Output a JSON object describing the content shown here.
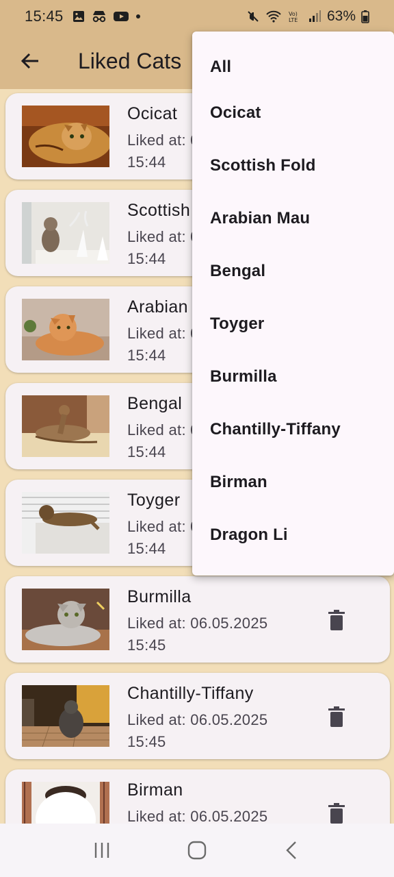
{
  "status_bar": {
    "time": "15:45",
    "battery": "63%",
    "icons_left": [
      "gallery-icon",
      "incognito-icon",
      "youtube-icon",
      "dot-icon"
    ],
    "icons_right": [
      "mute-icon",
      "wifi-icon",
      "volte-icon",
      "signal-icon",
      "battery-icon"
    ]
  },
  "app_bar": {
    "title": "Liked Cats",
    "back_icon": "arrow-left-icon"
  },
  "cards": [
    {
      "name": "Ocicat",
      "liked_label": "Liked at: 06.05.2025",
      "time": "15:44"
    },
    {
      "name": "Scottish Fold",
      "liked_label": "Liked at: 06.05.2025",
      "time": "15:44"
    },
    {
      "name": "Arabian Mau",
      "liked_label": "Liked at: 06.05.2025",
      "time": "15:44"
    },
    {
      "name": "Bengal",
      "liked_label": "Liked at: 06.05.2025",
      "time": "15:44"
    },
    {
      "name": "Toyger",
      "liked_label": "Liked at: 06.05.2025",
      "time": "15:44"
    },
    {
      "name": "Burmilla",
      "liked_label": "Liked at: 06.05.2025",
      "time": "15:45"
    },
    {
      "name": "Chantilly-Tiffany",
      "liked_label": "Liked at: 06.05.2025",
      "time": "15:45"
    },
    {
      "name": "Birman",
      "liked_label": "Liked at: 06.05.2025",
      "time": ""
    }
  ],
  "filter_menu": {
    "items": [
      "All",
      "Ocicat",
      "Scottish Fold",
      "Arabian Mau",
      "Bengal",
      "Toyger",
      "Burmilla",
      "Chantilly-Tiffany",
      "Birman",
      "Dragon Li"
    ]
  },
  "nav_bar": {
    "icons": [
      "recent-apps-icon",
      "home-icon",
      "back-nav-icon"
    ]
  },
  "colors": {
    "header": "#d9b98b",
    "background": "#f2deb8",
    "card": "#f6f1f4",
    "menu": "#fdf7fc",
    "icon": "#49454f"
  }
}
